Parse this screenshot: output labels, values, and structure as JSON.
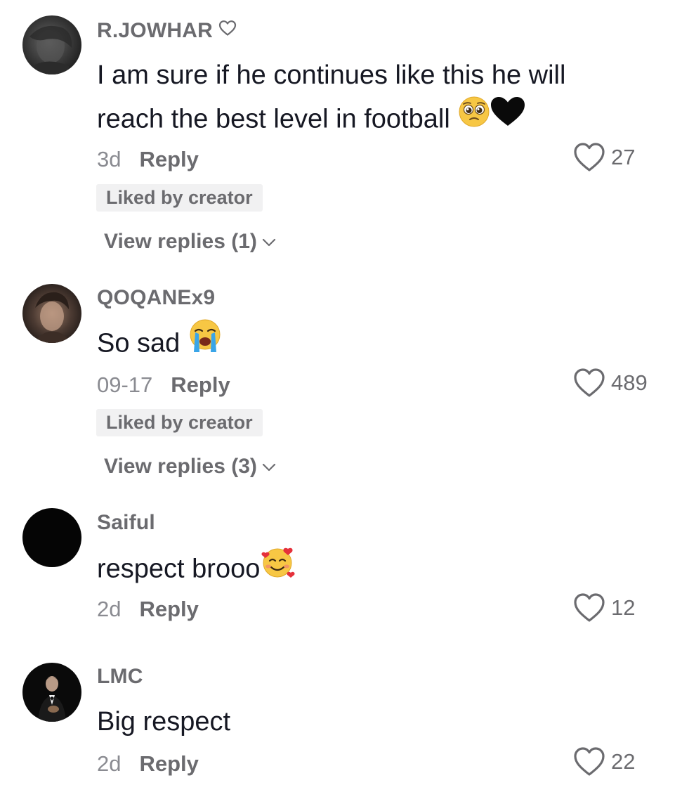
{
  "colors": {
    "text_primary": "#161823",
    "text_secondary": "#6b6b6f",
    "text_muted": "#8a8b91",
    "badge_bg": "#f1f1f2"
  },
  "comments": [
    {
      "username": "R.JOWHAR",
      "username_icon": "heart-outline-icon",
      "text": "I am sure if he continues like this he will reach the best level in football",
      "emojis": [
        "pleading-face-emoji",
        "black-heart-emoji"
      ],
      "time": "3d",
      "reply_label": "Reply",
      "likes": "27",
      "badge": "Liked by creator",
      "view_replies": "View replies (1)"
    },
    {
      "username": "QOQANEx9",
      "text": "So sad",
      "emojis": [
        "loudly-crying-face-emoji"
      ],
      "time": "09-17",
      "reply_label": "Reply",
      "likes": "489",
      "badge": "Liked by creator",
      "view_replies": "View replies (3)"
    },
    {
      "username": "Saiful",
      "text": "respect brooo",
      "emojis": [
        "smiling-face-with-hearts-emoji"
      ],
      "time": "2d",
      "reply_label": "Reply",
      "likes": "12"
    },
    {
      "username": "LMC",
      "text": "Big respect",
      "time": "2d",
      "reply_label": "Reply",
      "likes": "22"
    }
  ]
}
